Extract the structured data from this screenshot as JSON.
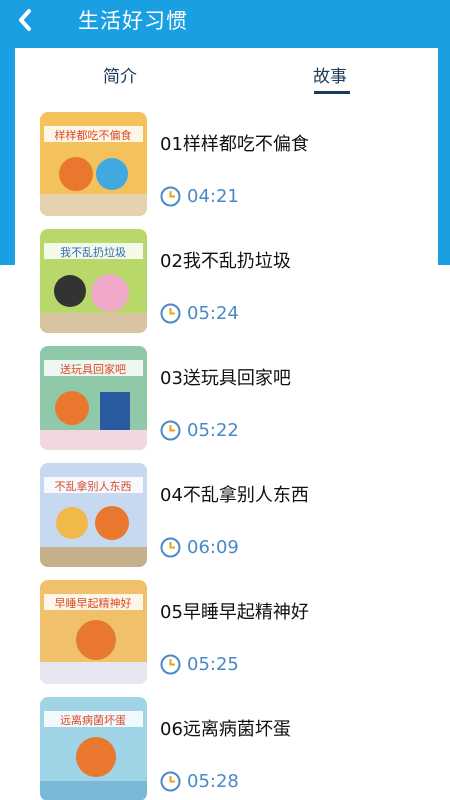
{
  "header": {
    "title": "生活好习惯"
  },
  "tabs": [
    {
      "label": "简介",
      "active": false
    },
    {
      "label": "故事",
      "active": true
    }
  ],
  "stories": [
    {
      "title": "01样样都吃不偏食",
      "duration": "04:21",
      "cover_text": "样样都吃不偏食",
      "cover_color": "#f3c25a"
    },
    {
      "title": "02我不乱扔垃圾",
      "duration": "05:24",
      "cover_text": "我不乱扔垃圾",
      "cover_color": "#b9d86a"
    },
    {
      "title": "03送玩具回家吧",
      "duration": "05:22",
      "cover_text": "送玩具回家吧",
      "cover_color": "#8fc9a8"
    },
    {
      "title": "04不乱拿别人东西",
      "duration": "06:09",
      "cover_text": "不乱拿别人东西",
      "cover_color": "#c7d9f0"
    },
    {
      "title": "05早睡早起精神好",
      "duration": "05:25",
      "cover_text": "早睡早起精神好",
      "cover_color": "#f0c06a"
    },
    {
      "title": "06远离病菌坏蛋",
      "duration": "05:28",
      "cover_text": "远离病菌坏蛋",
      "cover_color": "#9fd4e6"
    }
  ],
  "colors": {
    "accent": "#1a9fe3",
    "tab_active": "#1c3b5a",
    "duration": "#4a89c8"
  }
}
